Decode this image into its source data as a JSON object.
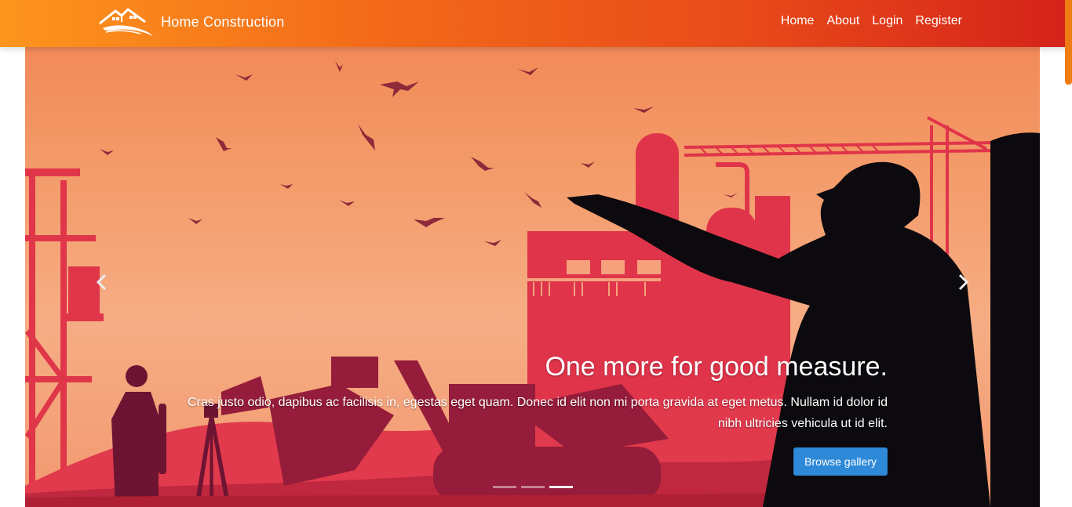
{
  "navbar": {
    "brand_text": "Home Construction",
    "brand_logo_icon": "house-roof-logo-icon",
    "links": [
      {
        "label": "Home"
      },
      {
        "label": "About"
      },
      {
        "label": "Login"
      },
      {
        "label": "Register"
      }
    ],
    "gradient_colors": [
      "#fd951d",
      "#d4221a"
    ]
  },
  "carousel": {
    "slide_count": 3,
    "active_index": 2,
    "prev_icon": "chevron-left-icon",
    "next_icon": "chevron-right-icon",
    "caption": {
      "heading": "One more for good measure.",
      "text": "Cras justo odio, dapibus ac facilisis in, egestas eget quam. Donec id elit non mi porta gravida at eget metus. Nullam id dolor id nibh ultricies vehicula ut id elit.",
      "button_label": "Browse gallery"
    },
    "accent_color": "#2e8ad8"
  }
}
